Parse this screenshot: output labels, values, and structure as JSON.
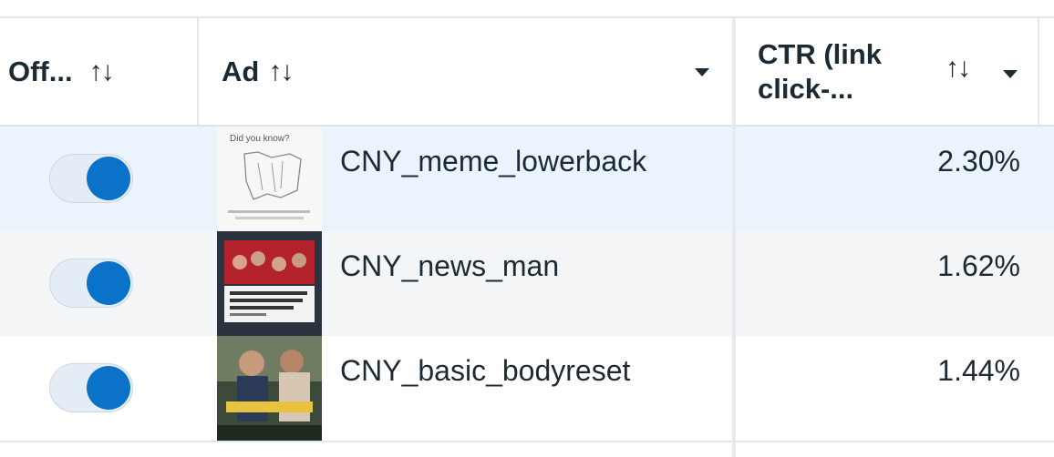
{
  "columns": {
    "off": {
      "label": "Off...",
      "sort_icon": "↑↓"
    },
    "ad": {
      "label": "Ad",
      "sort_icon": "↑↓"
    },
    "ctr": {
      "label_line1": "CTR (link",
      "label_line2": "click-...",
      "sort_icon": "↑↓"
    }
  },
  "rows": [
    {
      "enabled": true,
      "ad_name": "CNY_meme_lowerback",
      "ctr": "2.30%",
      "thumb_title": "Did you know?"
    },
    {
      "enabled": true,
      "ad_name": "CNY_news_man",
      "ctr": "1.62%"
    },
    {
      "enabled": true,
      "ad_name": "CNY_basic_bodyreset",
      "ctr": "1.44%"
    }
  ],
  "colors": {
    "accent": "#0a72c9",
    "selected_row": "#ebf3fd",
    "alt_row": "#f4f5f7"
  }
}
